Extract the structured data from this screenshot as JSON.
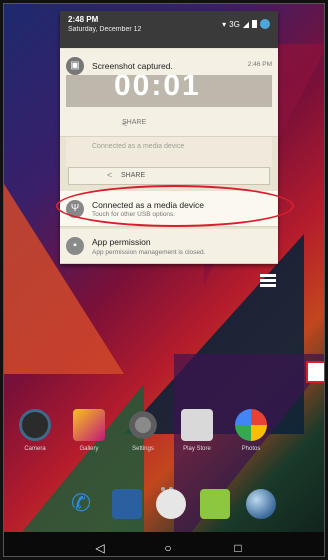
{
  "status_bar": {
    "time": "2:48 PM",
    "date": "Saturday, December 12",
    "network": "3G"
  },
  "notifications": {
    "screenshot": {
      "title": "Screenshot captured.",
      "time": "2:46 PM",
      "preview_text": "00:01",
      "share_label": "SHARE"
    },
    "ghost": {
      "title": "Connected as a media device",
      "share_label": "SHARE"
    },
    "usb": {
      "title": "Connected as a media device",
      "subtitle": "Touch for other USB options."
    },
    "app_permission": {
      "title": "App permission",
      "subtitle": "App permission management is closed."
    }
  },
  "home": {
    "apps": [
      {
        "label": "Camera",
        "icon": "camera-icon"
      },
      {
        "label": "Gallery",
        "icon": "gallery-icon"
      },
      {
        "label": "Settings",
        "icon": "gear-icon"
      },
      {
        "label": "Play Store",
        "icon": "play-store-icon"
      },
      {
        "label": "Photos",
        "icon": "photos-icon"
      }
    ],
    "dock": [
      {
        "icon": "phone-icon"
      },
      {
        "icon": "contacts-icon"
      },
      {
        "icon": "app-drawer-icon"
      },
      {
        "icon": "messaging-icon"
      },
      {
        "icon": "browser-icon"
      }
    ]
  },
  "navigation": {
    "back_glyph": "◁",
    "home_glyph": "○",
    "recent_glyph": "□"
  },
  "colors": {
    "highlight": "#d81e2c",
    "shade_header": "#3a3a3a",
    "notification_bg": "#f4f0e4"
  }
}
